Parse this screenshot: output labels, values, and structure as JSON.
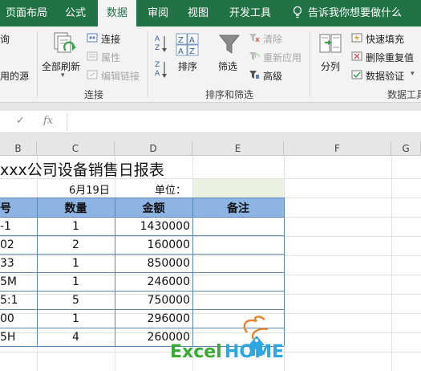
{
  "tabs": [
    {
      "label": "页面布局",
      "active": false
    },
    {
      "label": "公式",
      "active": false
    },
    {
      "label": "数据",
      "active": true
    },
    {
      "label": "审阅",
      "active": false
    },
    {
      "label": "视图",
      "active": false
    },
    {
      "label": "开发工具",
      "active": false
    }
  ],
  "tell_me": "告诉我你想要做什么",
  "ribbon": {
    "left_partial_1": "询",
    "left_partial_2": "用的源",
    "refresh_all": "全部刷新",
    "connections": "连接",
    "properties": "属性",
    "edit_links": "编辑链接",
    "group_connections": "连接",
    "sort": "排序",
    "filter": "筛选",
    "clear": "清除",
    "reapply": "重新应用",
    "advanced": "高级",
    "group_sort_filter": "排序和筛选",
    "text_to_columns": "分列",
    "flash_fill": "快速填充",
    "remove_duplicates": "删除重复值",
    "data_validation": "数据验证",
    "group_data_tools": "数据工具"
  },
  "formula_bar": {
    "fx": "fx",
    "cancel": "✓",
    "value": ""
  },
  "columns": [
    "B",
    "C",
    "D",
    "E",
    "F",
    "G"
  ],
  "sheet": {
    "title": "xxx公司设备销售日报表",
    "date": "6月19日",
    "unit_label": "单位：",
    "headers": [
      "号",
      "数量",
      "金额",
      "备注"
    ],
    "rows": [
      {
        "model": "-1",
        "qty": "1",
        "amount": "1430000",
        "note": ""
      },
      {
        "model": "02",
        "qty": "2",
        "amount": "160000",
        "note": ""
      },
      {
        "model": "33",
        "qty": "1",
        "amount": "850000",
        "note": ""
      },
      {
        "model": "5M",
        "qty": "1",
        "amount": "246000",
        "note": ""
      },
      {
        "model": "5:1",
        "qty": "5",
        "amount": "750000",
        "note": ""
      },
      {
        "model": "00",
        "qty": "1",
        "amount": "296000",
        "note": ""
      },
      {
        "model": "5H",
        "qty": "4",
        "amount": "260000",
        "note": ""
      }
    ]
  },
  "watermark": {
    "brand_left": "Excel",
    "brand_right": "HOME"
  },
  "colors": {
    "accent": "#217346",
    "header_fill": "#8db4e2",
    "unit_fill": "#ebf1de",
    "logo_green": "#3aaa35",
    "logo_blue": "#2ea7e0",
    "logo_orange": "#e8822b"
  }
}
